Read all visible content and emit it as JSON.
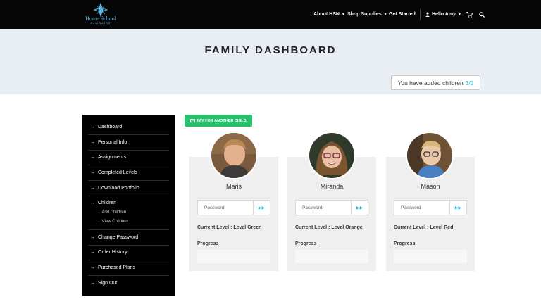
{
  "brand": {
    "logo_text": "Home School",
    "logo_sub": "NAVIGATOR"
  },
  "nav": {
    "items": [
      {
        "label": "About HSN",
        "has_caret": true
      },
      {
        "label": "Shop Supplies",
        "has_caret": true
      },
      {
        "label": "Get Started",
        "has_caret": false
      }
    ],
    "user_label": "Hello Amy",
    "user_icon": "user-icon",
    "cart_icon": "cart-icon",
    "search_icon": "search-icon"
  },
  "hero": {
    "title": "FAMILY DASHBOARD",
    "added_text": "You have added children",
    "added_count": "3/3"
  },
  "sidebar": {
    "items": [
      {
        "label": "Dashboard"
      },
      {
        "label": "Personal Info"
      },
      {
        "label": "Assignments"
      },
      {
        "label": "Completed Levels"
      },
      {
        "label": "Download Portfolio"
      },
      {
        "label": "Children",
        "sub": [
          "Add Children",
          "View Children"
        ]
      },
      {
        "label": "Change Password"
      },
      {
        "label": "Order History"
      },
      {
        "label": "Purchased Plans"
      },
      {
        "label": "Sign Out"
      }
    ]
  },
  "pay_button": {
    "icon": "card-icon",
    "label": "PAY FOR ANOTHER CHILD"
  },
  "children": [
    {
      "name": "Maris",
      "password_placeholder": "Password",
      "level": "Current Level : Level Green",
      "progress_label": "Progress"
    },
    {
      "name": "Miranda",
      "password_placeholder": "Password",
      "level": "Current Level : Level Orange",
      "progress_label": "Progress"
    },
    {
      "name": "Mason",
      "password_placeholder": "Password",
      "level": "Current Level : Level Red",
      "progress_label": "Progress"
    }
  ],
  "colors": {
    "accent": "#2bb5d8",
    "pay_green": "#28c06c",
    "hero_bg": "#e8eef3",
    "sidebar_bg": "#000000"
  }
}
